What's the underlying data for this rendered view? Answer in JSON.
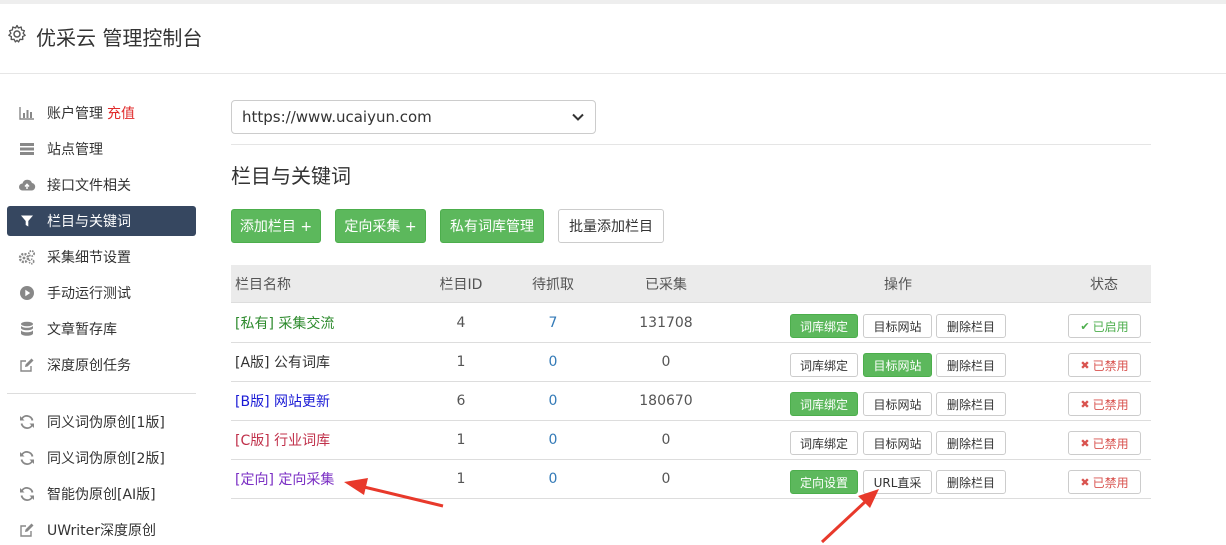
{
  "header": {
    "title": "优采云 管理控制台"
  },
  "sidebar": {
    "items": [
      {
        "label": "账户管理",
        "extra": "充值",
        "icon": "bar-chart-icon"
      },
      {
        "label": "站点管理",
        "icon": "server-icon"
      },
      {
        "label": "接口文件相关",
        "icon": "cloud-upload-icon"
      },
      {
        "label": "栏目与关键词",
        "icon": "filter-icon",
        "active": true
      },
      {
        "label": "采集细节设置",
        "icon": "cogs-icon"
      },
      {
        "label": "手动运行测试",
        "icon": "play-circle-icon"
      },
      {
        "label": "文章暂存库",
        "icon": "database-icon"
      },
      {
        "label": "深度原创任务",
        "icon": "edit-icon"
      },
      {
        "label": "同义词伪原创[1版]",
        "icon": "refresh-icon"
      },
      {
        "label": "同义词伪原创[2版]",
        "icon": "refresh-icon"
      },
      {
        "label": "智能伪原创[AI版]",
        "icon": "refresh-icon"
      },
      {
        "label": "UWriter深度原创",
        "icon": "edit-icon"
      }
    ]
  },
  "site_select": {
    "value": "https://www.ucaiyun.com"
  },
  "section": {
    "title": "栏目与关键词"
  },
  "toolbar": {
    "add_column": "添加栏目 +",
    "directed_collect": "定向采集 +",
    "private_lexicon": "私有词库管理",
    "batch_add": "批量添加栏目"
  },
  "table": {
    "headers": {
      "name": "栏目名称",
      "id": "栏目ID",
      "pending": "待抓取",
      "collected": "已采集",
      "ops": "操作",
      "status": "状态"
    },
    "rows": [
      {
        "name": "[私有] 采集交流",
        "name_color": "#2e8b2e",
        "id": "4",
        "pending": "7",
        "collected": "131708",
        "op1": "词库绑定",
        "op1_green": true,
        "op2": "目标网站",
        "op2_green": false,
        "op3": "删除栏目",
        "status": "已启用",
        "status_on": true
      },
      {
        "name": "[A版] 公有词库",
        "name_color": "#333333",
        "id": "1",
        "pending": "0",
        "collected": "0",
        "op1": "词库绑定",
        "op1_green": false,
        "op2": "目标网站",
        "op2_green": true,
        "op3": "删除栏目",
        "status": "已禁用",
        "status_on": false
      },
      {
        "name": "[B版] 网站更新",
        "name_color": "#1a1ad6",
        "id": "6",
        "pending": "0",
        "collected": "180670",
        "op1": "词库绑定",
        "op1_green": true,
        "op2": "目标网站",
        "op2_green": false,
        "op3": "删除栏目",
        "status": "已禁用",
        "status_on": false
      },
      {
        "name": "[C版] 行业词库",
        "name_color": "#c0304a",
        "id": "1",
        "pending": "0",
        "collected": "0",
        "op1": "词库绑定",
        "op1_green": false,
        "op2": "目标网站",
        "op2_green": false,
        "op3": "删除栏目",
        "status": "已禁用",
        "status_on": false
      },
      {
        "name": "[定向] 定向采集",
        "name_color": "#7b2fc4",
        "id": "1",
        "pending": "0",
        "collected": "0",
        "op1": "定向设置",
        "op1_green": true,
        "op2": "URL直采",
        "op2_green": false,
        "op3": "删除栏目",
        "status": "已禁用",
        "status_on": false
      }
    ]
  },
  "colors": {
    "green": "#5cb85c",
    "active_nav": "#364760",
    "link_blue": "#337ab7",
    "danger": "#e02b2b",
    "arrow": "#e8392b"
  }
}
